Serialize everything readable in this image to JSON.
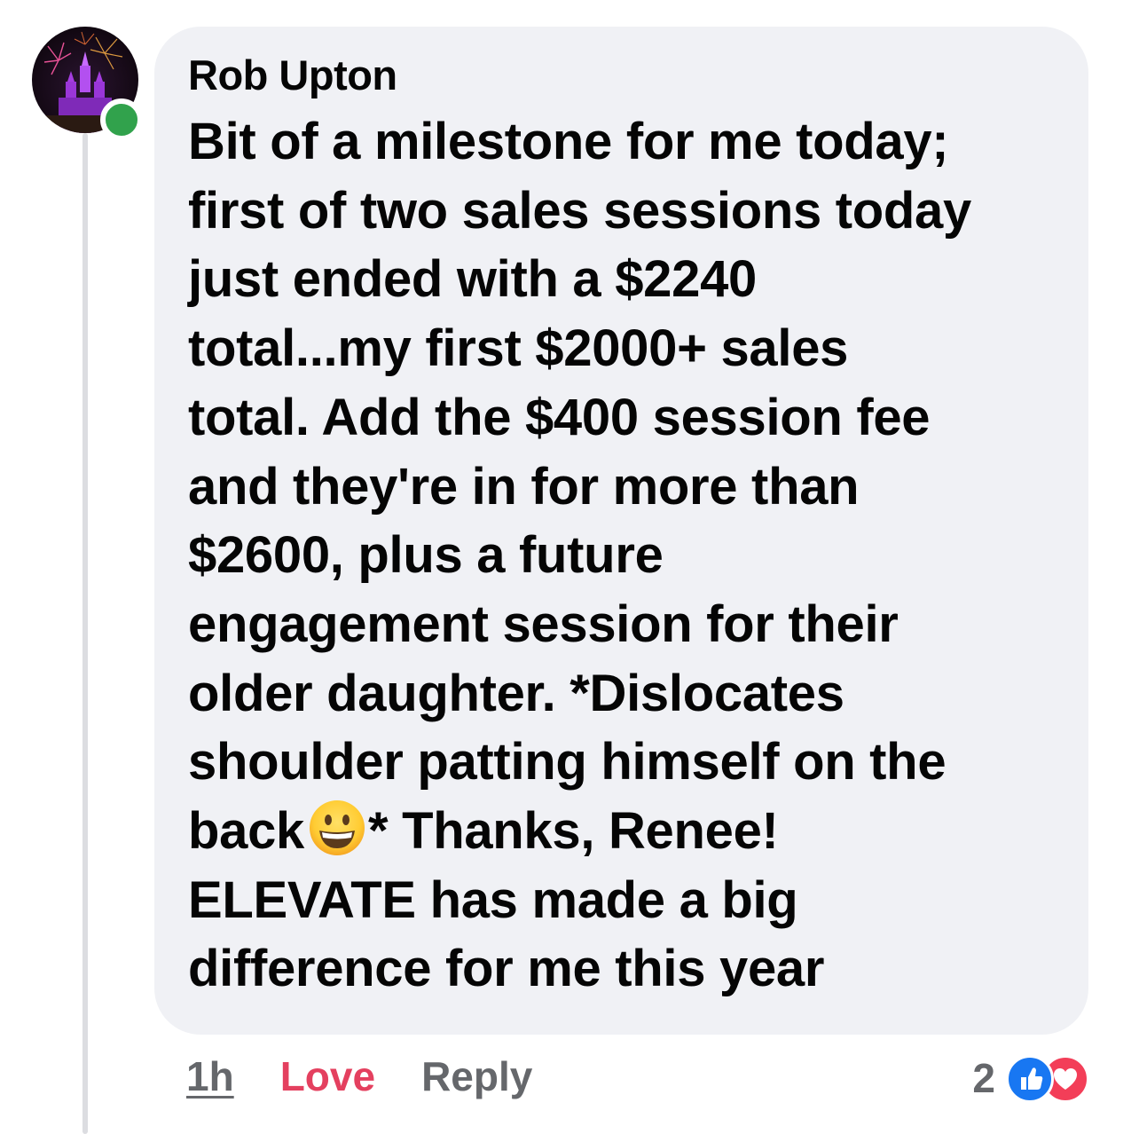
{
  "comment": {
    "author": "Rob Upton",
    "lines": [
      "Bit of a milestone for me today;",
      "first of two sales sessions today",
      "just ended with a $2240",
      "total...my first $2000+ sales",
      "total. Add the $400 session fee",
      "and they're in for more than",
      "$2600, plus a future",
      "engagement session for their",
      "older daughter. *Dislocates",
      "shoulder patting himself on the"
    ],
    "emoji_line_before": "back",
    "emoji_line_after": "* Thanks, Renee!",
    "lines_after": [
      "ELEVATE has made a big",
      "difference for me this year"
    ],
    "emoji": "grinning-face-emoji"
  },
  "actions": {
    "time": "1h",
    "love": "Love",
    "reply": "Reply"
  },
  "reactions": {
    "count": "2",
    "icons": [
      "like-icon",
      "love-icon"
    ]
  },
  "colors": {
    "bubble": "#f0f1f5",
    "online": "#31a24c",
    "love_action": "#e4405f",
    "like_reaction": "#1877f2",
    "love_reaction": "#f33e58",
    "muted": "#65676b"
  }
}
